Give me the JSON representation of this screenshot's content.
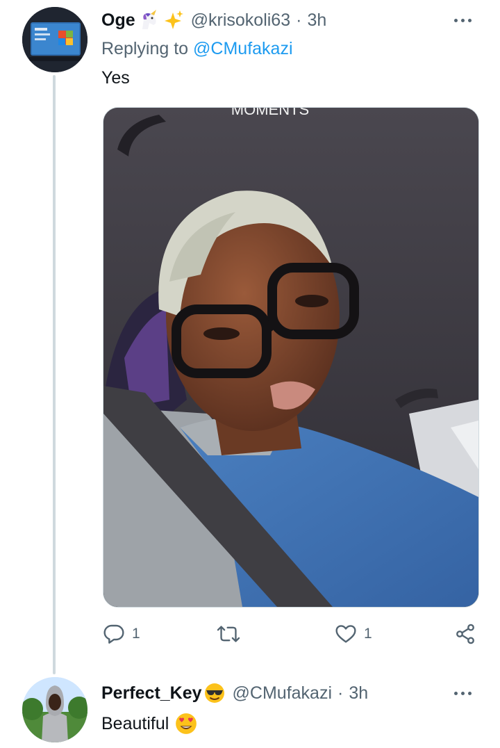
{
  "tweet1": {
    "display_name": "Oge",
    "handle": "@krisokoli63",
    "separator": "·",
    "time": "3h",
    "reply_prefix": "Replying to",
    "reply_mention": "@CMufakazi",
    "text": "Yes",
    "media_caption": "MOMENTS",
    "counts": {
      "replies": "1",
      "likes": "1"
    },
    "icons": [
      "unicorn-emoji",
      "sparkles-emoji",
      "more-icon",
      "reply-icon",
      "retweet-icon",
      "like-icon",
      "share-icon"
    ]
  },
  "tweet2": {
    "display_name": "Perfect_Key",
    "handle": "@CMufakazi",
    "separator": "·",
    "time": "3h",
    "text": "Beautiful",
    "icons": [
      "sunglasses-emoji",
      "heart-eyes-emoji",
      "more-icon"
    ]
  },
  "colors": {
    "accent": "#1d9bf0",
    "muted": "#536471",
    "thread_line": "#cfd9de"
  }
}
